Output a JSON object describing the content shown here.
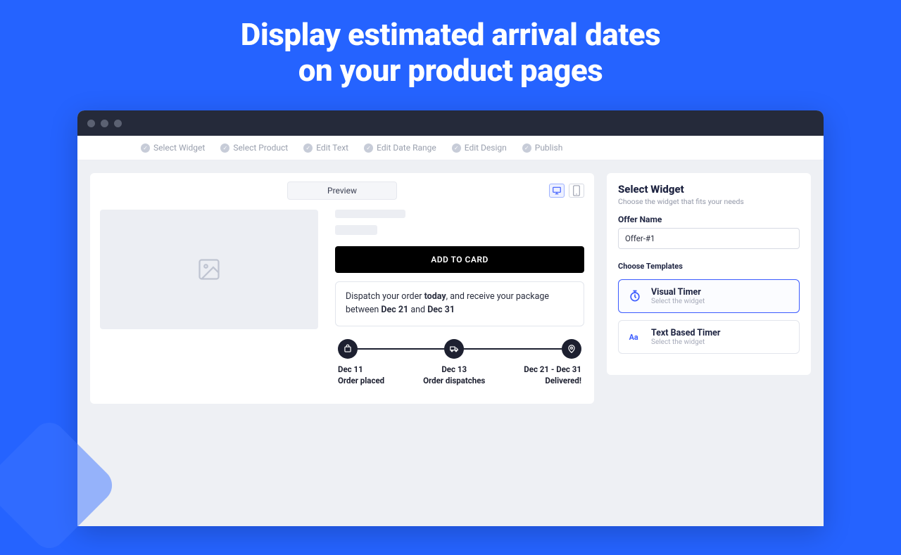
{
  "hero": {
    "line1": "Display estimated arrival dates",
    "line2": "on your product pages"
  },
  "steps": [
    "Select Widget",
    "Select Product",
    "Edit Text",
    "Edit Date Range",
    "Edit Design",
    "Publish"
  ],
  "preview": {
    "tab": "Preview",
    "atc": "ADD TO CARD",
    "dispatch": {
      "pre": "Dispatch your order ",
      "today": "today",
      "mid": ", and receive your package between ",
      "d1": "Dec 21",
      "and": " and ",
      "d2": "Dec 31"
    },
    "timeline": [
      {
        "date": "Dec 11",
        "label": "Order placed"
      },
      {
        "date": "Dec 13",
        "label": "Order dispatches"
      },
      {
        "date": "Dec 21 - Dec 31",
        "label": "Delivered!"
      }
    ]
  },
  "side": {
    "title": "Select Widget",
    "sub": "Choose the widget that fits your needs",
    "offer_label": "Offer Name",
    "offer_value": "Offer-#1",
    "choose": "Choose Templates",
    "templates": [
      {
        "title": "Visual Timer",
        "sub": "Select the widget"
      },
      {
        "title": "Text Based Timer",
        "sub": "Select the widget"
      }
    ]
  }
}
